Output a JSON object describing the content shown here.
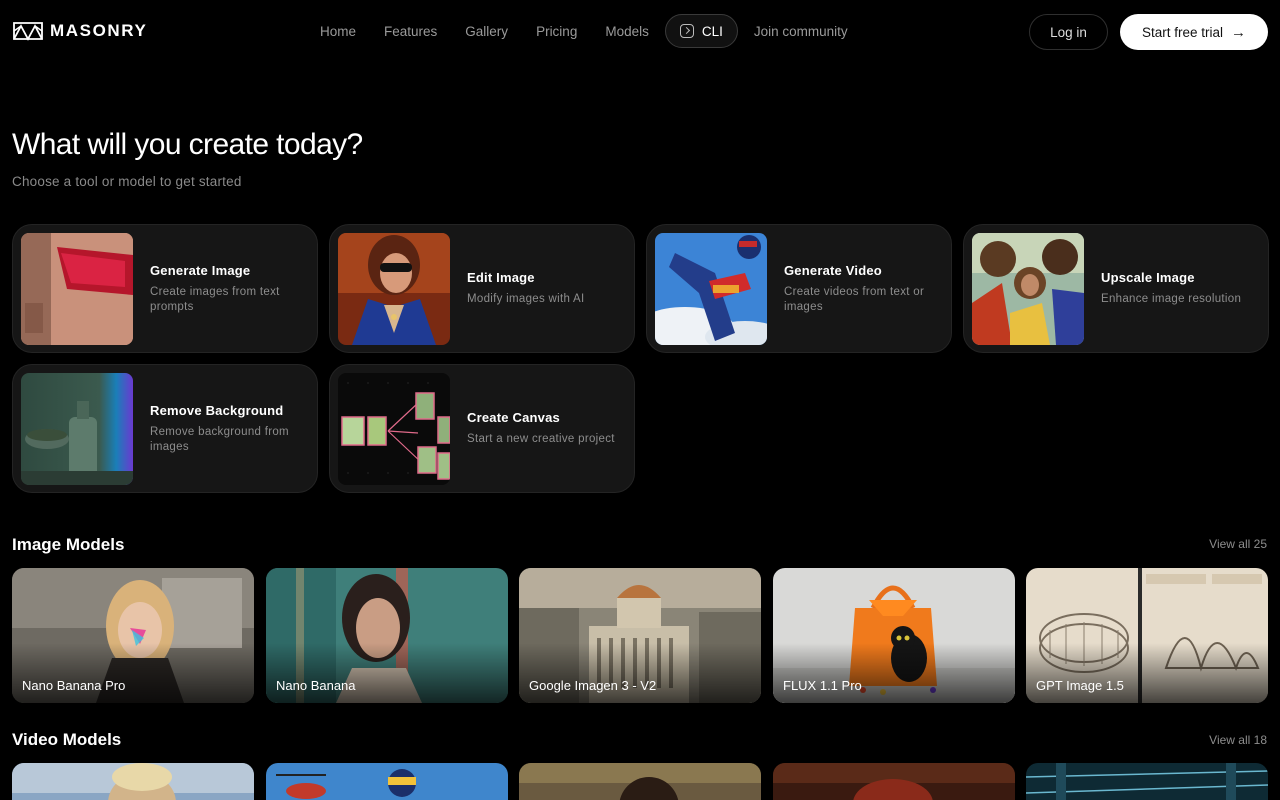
{
  "brand": {
    "name": "MASONRY"
  },
  "nav": {
    "items": [
      {
        "label": "Home"
      },
      {
        "label": "Features"
      },
      {
        "label": "Gallery"
      },
      {
        "label": "Pricing"
      },
      {
        "label": "Models"
      },
      {
        "label": "CLI"
      },
      {
        "label": "Join community"
      }
    ]
  },
  "auth": {
    "login": "Log in",
    "trial": "Start free trial",
    "trial_icon": "arrow-right-icon"
  },
  "hero": {
    "title": "What will you create today?",
    "subtitle": "Choose a tool or model to get started"
  },
  "tools": [
    {
      "title": "Generate Image",
      "desc": "Create images from text prompts"
    },
    {
      "title": "Edit Image",
      "desc": "Modify images with AI"
    },
    {
      "title": "Generate Video",
      "desc": "Create videos from text or images"
    },
    {
      "title": "Upscale Image",
      "desc": "Enhance image resolution"
    },
    {
      "title": "Remove Background",
      "desc": "Remove background from images"
    },
    {
      "title": "Create Canvas",
      "desc": "Start a new creative project"
    }
  ],
  "image_models": {
    "title": "Image Models",
    "view_all": "View all 25",
    "items": [
      {
        "name": "Nano Banana Pro"
      },
      {
        "name": "Nano Banana"
      },
      {
        "name": "Google Imagen 3 - V2"
      },
      {
        "name": "FLUX 1.1 Pro"
      },
      {
        "name": "GPT Image 1.5"
      }
    ]
  },
  "video_models": {
    "title": "Video Models",
    "view_all": "View all 18"
  }
}
